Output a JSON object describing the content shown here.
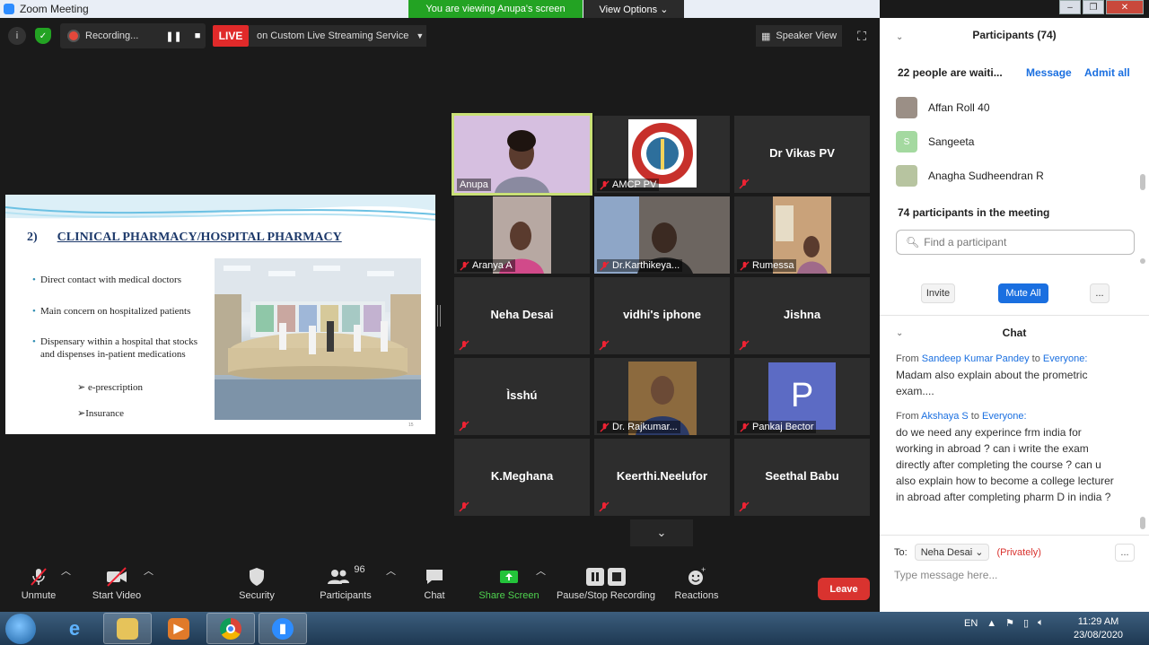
{
  "window": {
    "title": "Zoom Meeting",
    "viewing_banner": "You are viewing Anupa's screen",
    "view_options": "View Options ⌄"
  },
  "topbar": {
    "recording_label": "Recording...",
    "live_label": "LIVE",
    "streaming_label": "on Custom Live Streaming Service",
    "speaker_view": "Speaker View"
  },
  "slide": {
    "number": "2)",
    "title": "CLINICAL PHARMACY/HOSPITAL PHARMACY",
    "bullets": [
      "Direct contact with medical doctors",
      "Main concern on hospitalized patients",
      "Dispensary within a hospital that stocks and dispenses in-patient medications"
    ],
    "subitems": [
      "➢ e-prescription",
      "➢Insurance"
    ],
    "page": "15"
  },
  "tiles": [
    {
      "label": "Anupa",
      "name": ""
    },
    {
      "label": "AMCP PV",
      "name": ""
    },
    {
      "label": "",
      "name": "Dr Vikas PV"
    },
    {
      "label": "Aranya A",
      "name": ""
    },
    {
      "label": "Dr.Karthikeya...",
      "name": ""
    },
    {
      "label": "Rumessa",
      "name": ""
    },
    {
      "label": "",
      "name": "Neha Desai"
    },
    {
      "label": "",
      "name": "vidhi's iphone"
    },
    {
      "label": "",
      "name": "Jishna"
    },
    {
      "label": "",
      "name": "Ìsshú"
    },
    {
      "label": "Dr. Rajkumar...",
      "name": ""
    },
    {
      "label": "Pankaj Bector",
      "name": "",
      "avatar_letter": "P"
    },
    {
      "label": "",
      "name": "K.Meghana"
    },
    {
      "label": "",
      "name": "Keerthi.Neelufor"
    },
    {
      "label": "",
      "name": "Seethal Babu"
    }
  ],
  "toolbar": {
    "unmute": "Unmute",
    "start_video": "Start Video",
    "security": "Security",
    "participants_count": "96",
    "participants": "Participants",
    "chat": "Chat",
    "share_screen": "Share Screen",
    "pause_stop": "Pause/Stop Recording",
    "reactions": "Reactions",
    "leave": "Leave"
  },
  "participants_panel": {
    "title": "Participants (74)",
    "waiting": "22 people are waiti...",
    "message": "Message",
    "admit_all": "Admit all",
    "waiting_list": [
      {
        "name": "Affan Roll 40",
        "color": "#9b8f86",
        "letter": ""
      },
      {
        "name": "Sangeeta",
        "color": "#a4d9a0",
        "letter": "S"
      },
      {
        "name": "Anagha Sudheendran R",
        "color": "#b7c4a0",
        "letter": ""
      }
    ],
    "in_meeting": "74 participants in the meeting",
    "find_placeholder": "Find a participant",
    "invite": "Invite",
    "mute_all": "Mute All",
    "more": "..."
  },
  "chat": {
    "title": "Chat",
    "messages": [
      {
        "from_prefix": "From",
        "sender": "Sandeep Kumar Pandey",
        "to_word": "to",
        "recipient": "Everyone:",
        "text": "Madam also explain about the prometric exam...."
      },
      {
        "from_prefix": "From",
        "sender": "Akshaya S",
        "to_word": "to",
        "recipient": "Everyone:",
        "text": "do we need any experince frm india for working in abroad ? can i write the exam directly after completing the course ? can u also explain how to become a college lecturer  in abroad after completing pharm D in india ?"
      }
    ],
    "to_label": "To:",
    "to_value": "Neha Desai ⌄",
    "privately": "(Privately)",
    "more": "...",
    "type_placeholder": "Type message here..."
  },
  "taskbar": {
    "lang": "EN",
    "time": "11:29 AM",
    "date": "23/08/2020"
  }
}
